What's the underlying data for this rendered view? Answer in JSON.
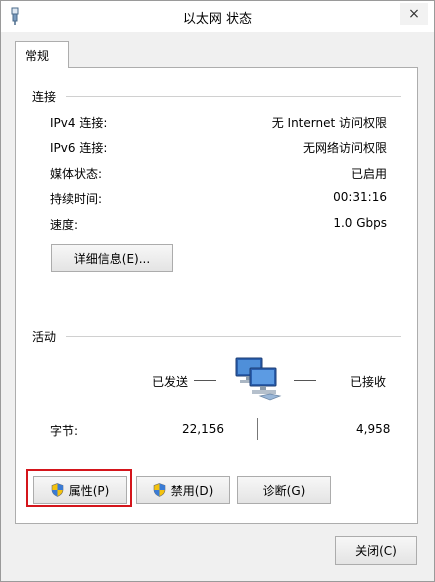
{
  "window": {
    "title": "以太网 状态",
    "close_label": "×"
  },
  "tabs": [
    {
      "label": "常规",
      "selected": true
    }
  ],
  "connection": {
    "group_title": "连接",
    "rows": [
      {
        "label": "IPv4 连接:",
        "value": "无 Internet 访问权限"
      },
      {
        "label": "IPv6 连接:",
        "value": "无网络访问权限"
      },
      {
        "label": "媒体状态:",
        "value": "已启用"
      },
      {
        "label": "持续时间:",
        "value": "00:31:16"
      },
      {
        "label": "速度:",
        "value": "1.0 Gbps"
      }
    ],
    "details_button": "详细信息(E)..."
  },
  "activity": {
    "group_title": "活动",
    "sent_label": "已发送",
    "received_label": "已接收",
    "bytes_label": "字节:",
    "bytes_sent": "22,156",
    "bytes_received": "4,958",
    "icon": "network-computer-icon"
  },
  "buttons": {
    "properties": "属性(P)",
    "disable": "禁用(D)",
    "diagnose": "诊断(G)",
    "close": "关闭(C)"
  },
  "colors": {
    "highlight": "#d4151b",
    "window_bg": "#f0f0f0",
    "panel_bg": "#ffffff"
  }
}
